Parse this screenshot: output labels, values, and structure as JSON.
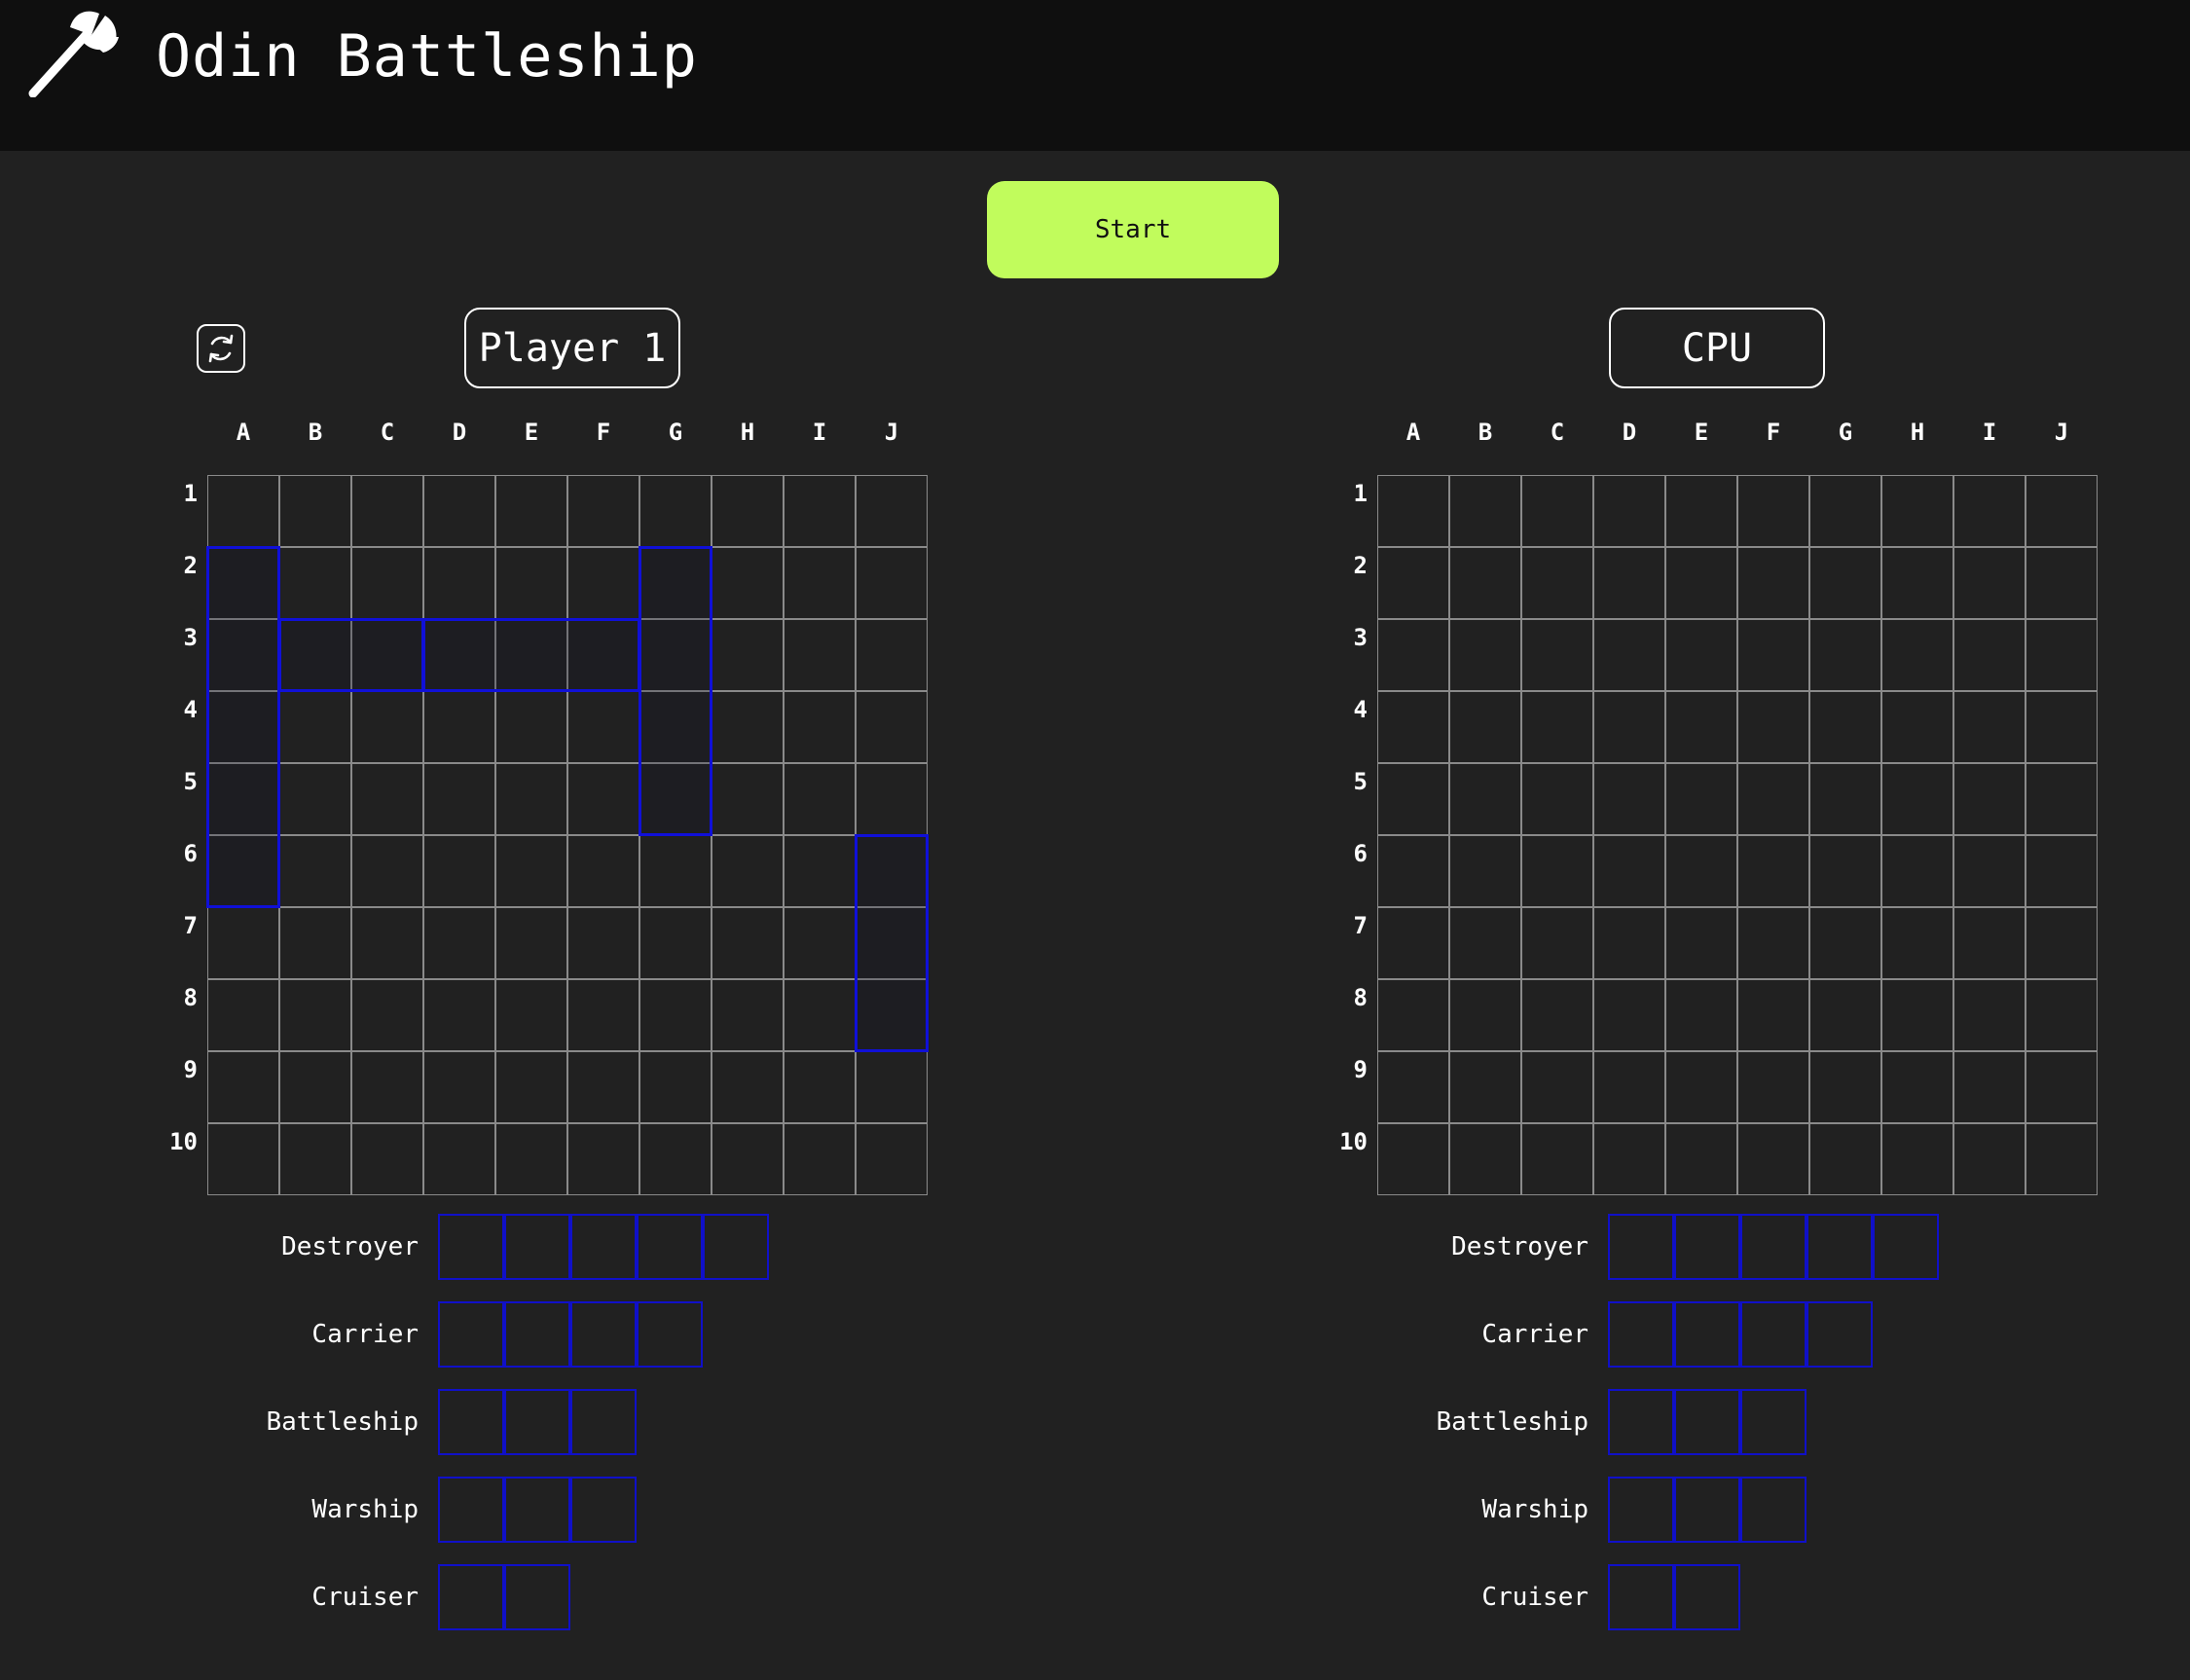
{
  "header": {
    "title": "Odin Battleship",
    "logo_icon": "axe-icon"
  },
  "controls": {
    "start_label": "Start",
    "reset_icon": "refresh-icon"
  },
  "colors": {
    "accent": "#c1fc5c",
    "ship_border": "#1010d8",
    "grid_line": "#8a8a8a",
    "background": "#212121",
    "header_bg": "#0f0f0f"
  },
  "columns": [
    "A",
    "B",
    "C",
    "D",
    "E",
    "F",
    "G",
    "H",
    "I",
    "J"
  ],
  "rows": [
    "1",
    "2",
    "3",
    "4",
    "5",
    "6",
    "7",
    "8",
    "9",
    "10"
  ],
  "boards": [
    {
      "player": "Player 1",
      "placed_ships": [
        {
          "cells": [
            "A2",
            "A3",
            "A4",
            "A5",
            "A6"
          ]
        },
        {
          "cells": [
            "B3",
            "C3"
          ]
        },
        {
          "cells": [
            "D3",
            "E3",
            "F3"
          ]
        },
        {
          "cells": [
            "G2",
            "G3",
            "G4",
            "G5"
          ]
        },
        {
          "cells": [
            "J6",
            "J7",
            "J8"
          ]
        }
      ],
      "fleet": [
        {
          "name": "Destroyer",
          "size": 5
        },
        {
          "name": "Carrier",
          "size": 4
        },
        {
          "name": "Battleship",
          "size": 3
        },
        {
          "name": "Warship",
          "size": 3
        },
        {
          "name": "Cruiser",
          "size": 2
        }
      ]
    },
    {
      "player": "CPU",
      "placed_ships": [],
      "fleet": [
        {
          "name": "Destroyer",
          "size": 5
        },
        {
          "name": "Carrier",
          "size": 4
        },
        {
          "name": "Battleship",
          "size": 3
        },
        {
          "name": "Warship",
          "size": 3
        },
        {
          "name": "Cruiser",
          "size": 2
        }
      ]
    }
  ]
}
